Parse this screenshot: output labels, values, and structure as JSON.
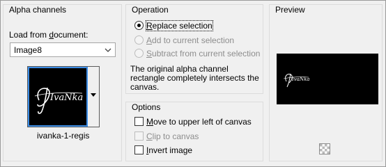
{
  "alpha_channels": {
    "title": "Alpha channels",
    "load_label_prefix": "Load from ",
    "load_label_underlined": "d",
    "load_label_suffix": "ocument:",
    "document_value": "Image8",
    "channel_name": "ivanka-1-regis",
    "logo_text": "IvaNka"
  },
  "operation": {
    "title": "Operation",
    "options": [
      {
        "underlined": "R",
        "rest": "eplace selection",
        "checked": true,
        "enabled": true
      },
      {
        "underlined": "A",
        "rest": "dd to current selection",
        "checked": false,
        "enabled": false
      },
      {
        "underlined": "S",
        "rest": "ubtract from current selection",
        "checked": false,
        "enabled": false
      }
    ],
    "message_line1": "The original alpha channel",
    "message_line2": "rectangle completely intersects the",
    "message_line3": "canvas."
  },
  "options": {
    "title": "Options",
    "items": [
      {
        "underlined": "M",
        "rest": "ove to upper left of canvas",
        "checked": false,
        "enabled": true
      },
      {
        "underlined": "C",
        "rest": "lip to canvas",
        "checked": false,
        "enabled": false
      },
      {
        "underlined": "I",
        "rest": "nvert image",
        "checked": false,
        "enabled": true
      }
    ]
  },
  "preview": {
    "title": "Preview"
  },
  "colors": {
    "thumbnail_highlight": "#3c8de6",
    "disabled_text": "#8d8d8d"
  }
}
